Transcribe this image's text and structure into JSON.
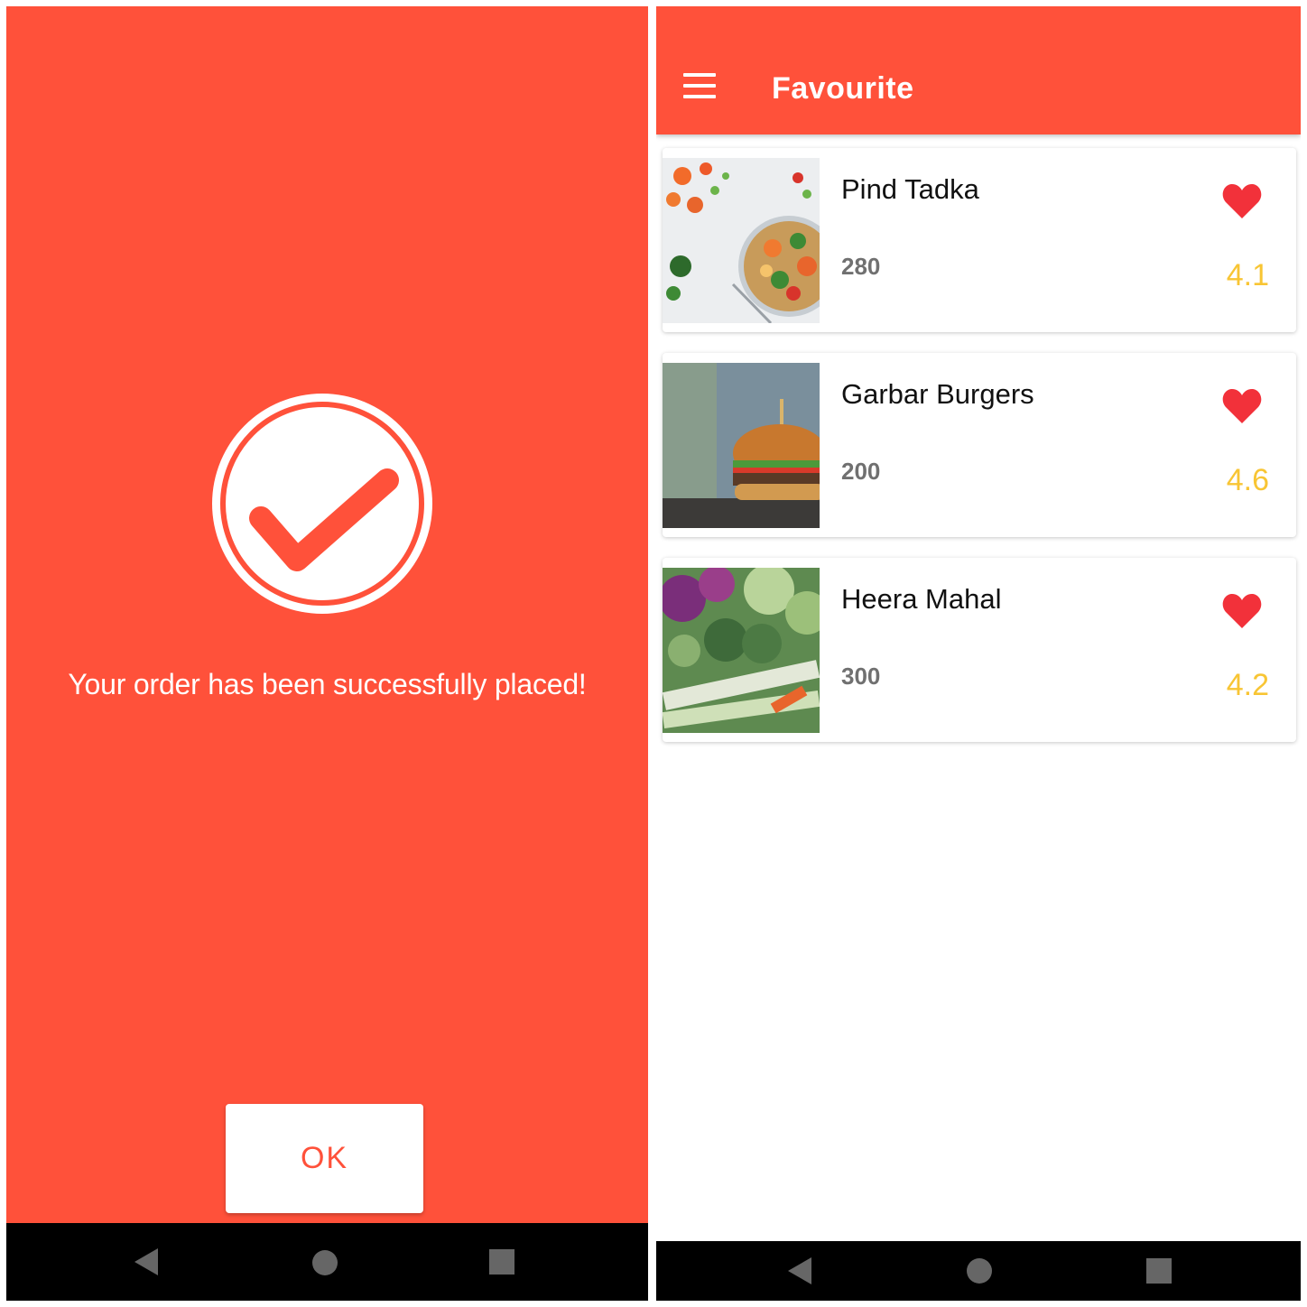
{
  "order_success": {
    "message": "Your order has been successfully placed!",
    "ok_label": "OK",
    "icon": "check-circle-icon"
  },
  "favourites": {
    "title": "Favourite",
    "menu_icon": "hamburger-menu-icon",
    "items": [
      {
        "name": "Pind Tadka",
        "price": "280",
        "rating": "4.1",
        "favourited": true,
        "image": "salad-bowl-photo"
      },
      {
        "name": "Garbar Burgers",
        "price": "200",
        "rating": "4.6",
        "favourited": true,
        "image": "burger-photo"
      },
      {
        "name": "Heera Mahal",
        "price": "300",
        "rating": "4.2",
        "favourited": true,
        "image": "vegetables-photo"
      }
    ]
  },
  "system_nav": {
    "back": "back-icon",
    "home": "home-icon",
    "recents": "recents-icon"
  },
  "colors": {
    "primary": "#FF513A",
    "rating": "#F8C534",
    "heart": "#F2313A",
    "nav_bar": "#000000"
  }
}
